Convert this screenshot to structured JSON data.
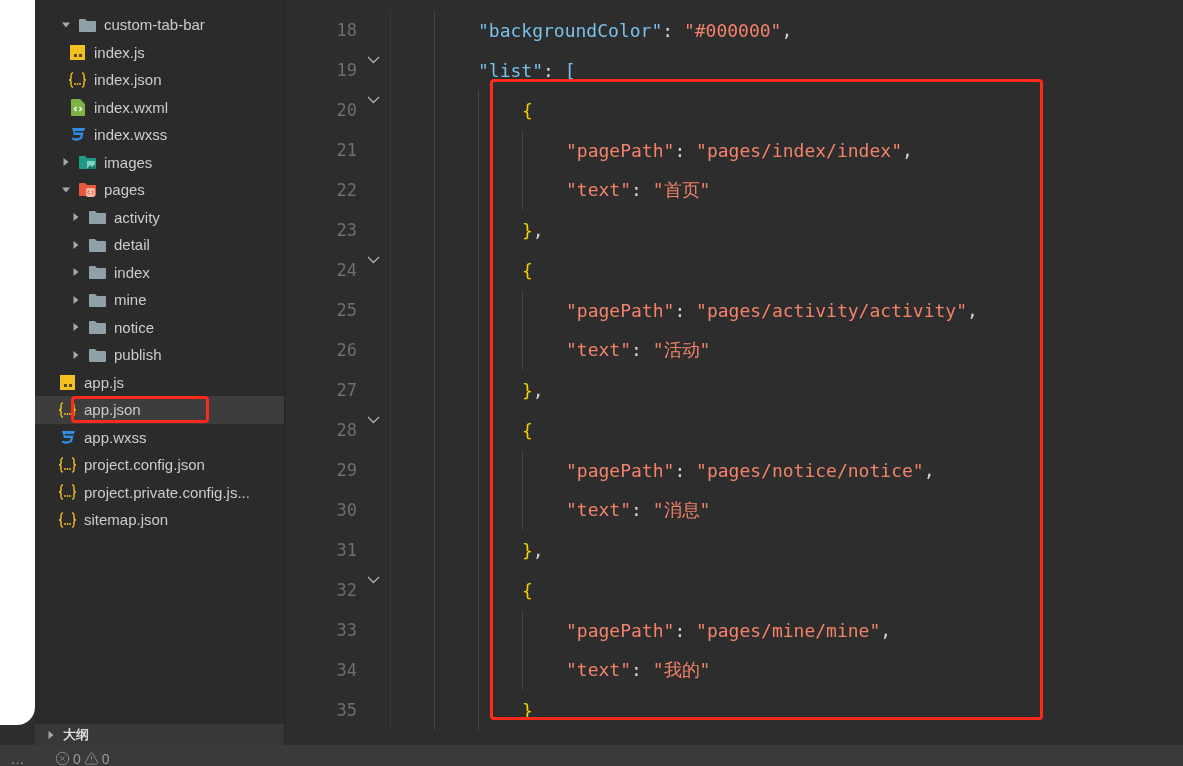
{
  "explorer": {
    "items": [
      {
        "name": "custom-tab-bar",
        "kind": "folder",
        "expanded": true,
        "selected": false,
        "children": [
          {
            "name": "index.js",
            "kind": "js",
            "selected": false
          },
          {
            "name": "index.json",
            "kind": "json",
            "selected": false
          },
          {
            "name": "index.wxml",
            "kind": "wxml",
            "selected": false
          },
          {
            "name": "index.wxss",
            "kind": "wxss",
            "selected": false
          }
        ]
      },
      {
        "name": "images",
        "kind": "image-folder",
        "expanded": false,
        "selected": false
      },
      {
        "name": "pages",
        "kind": "pages-folder",
        "expanded": true,
        "selected": false,
        "children": [
          {
            "name": "activity",
            "kind": "folder",
            "expanded": false,
            "selected": false
          },
          {
            "name": "detail",
            "kind": "folder",
            "expanded": false,
            "selected": false
          },
          {
            "name": "index",
            "kind": "folder",
            "expanded": false,
            "selected": false
          },
          {
            "name": "mine",
            "kind": "folder",
            "expanded": false,
            "selected": false
          },
          {
            "name": "notice",
            "kind": "folder",
            "expanded": false,
            "selected": false
          },
          {
            "name": "publish",
            "kind": "folder",
            "expanded": false,
            "selected": false
          }
        ]
      },
      {
        "name": "app.js",
        "kind": "js",
        "selected": false
      },
      {
        "name": "app.json",
        "kind": "json",
        "selected": true
      },
      {
        "name": "app.wxss",
        "kind": "wxss",
        "selected": false
      },
      {
        "name": "project.config.json",
        "kind": "json",
        "selected": false
      },
      {
        "name": "project.private.config.js...",
        "kind": "json",
        "selected": false
      },
      {
        "name": "sitemap.json",
        "kind": "json",
        "selected": false
      }
    ]
  },
  "outline": {
    "title": "大纲",
    "expanded": false
  },
  "editor": {
    "lines": [
      {
        "number": "18",
        "fold": false,
        "tokens": [
          {
            "kind": "prop",
            "text": "\"backgroundColor\""
          },
          {
            "kind": "punct",
            "text": ": "
          },
          {
            "kind": "str",
            "text": "\"#000000\""
          },
          {
            "kind": "punct",
            "text": ","
          }
        ]
      },
      {
        "number": "19",
        "fold": true,
        "tokens": [
          {
            "kind": "prop",
            "text": "\"list\""
          },
          {
            "kind": "punct",
            "text": ": "
          },
          {
            "kind": "bracket",
            "text": "["
          }
        ],
        "children": [
          {
            "number": "20",
            "fold": true,
            "tokens": [
              {
                "kind": "brace",
                "text": "{"
              }
            ],
            "children": [
              {
                "number": "21",
                "fold": false,
                "tokens": [
                  {
                    "kind": "key",
                    "text": "\"pagePath\""
                  },
                  {
                    "kind": "punct",
                    "text": ": "
                  },
                  {
                    "kind": "str",
                    "text": "\"pages/index/index\""
                  },
                  {
                    "kind": "punct",
                    "text": ","
                  }
                ]
              },
              {
                "number": "22",
                "fold": false,
                "tokens": [
                  {
                    "kind": "key",
                    "text": "\"text\""
                  },
                  {
                    "kind": "punct",
                    "text": ": "
                  },
                  {
                    "kind": "str",
                    "text": "\"首页\""
                  }
                ]
              }
            ]
          },
          {
            "number": "23",
            "fold": false,
            "tokens": [
              {
                "kind": "brace",
                "text": "}"
              },
              {
                "kind": "punct",
                "text": ","
              }
            ]
          },
          {
            "number": "24",
            "fold": true,
            "tokens": [
              {
                "kind": "brace",
                "text": "{"
              }
            ],
            "children": [
              {
                "number": "25",
                "fold": false,
                "tokens": [
                  {
                    "kind": "key",
                    "text": "\"pagePath\""
                  },
                  {
                    "kind": "punct",
                    "text": ": "
                  },
                  {
                    "kind": "str",
                    "text": "\"pages/activity/activity\""
                  },
                  {
                    "kind": "punct",
                    "text": ","
                  }
                ]
              },
              {
                "number": "26",
                "fold": false,
                "tokens": [
                  {
                    "kind": "key",
                    "text": "\"text\""
                  },
                  {
                    "kind": "punct",
                    "text": ": "
                  },
                  {
                    "kind": "str",
                    "text": "\"活动\""
                  }
                ]
              }
            ]
          },
          {
            "number": "27",
            "fold": false,
            "tokens": [
              {
                "kind": "brace",
                "text": "}"
              },
              {
                "kind": "punct",
                "text": ","
              }
            ]
          },
          {
            "number": "28",
            "fold": true,
            "tokens": [
              {
                "kind": "brace",
                "text": "{"
              }
            ],
            "children": [
              {
                "number": "29",
                "fold": false,
                "tokens": [
                  {
                    "kind": "key",
                    "text": "\"pagePath\""
                  },
                  {
                    "kind": "punct",
                    "text": ": "
                  },
                  {
                    "kind": "str",
                    "text": "\"pages/notice/notice\""
                  },
                  {
                    "kind": "punct",
                    "text": ","
                  }
                ]
              },
              {
                "number": "30",
                "fold": false,
                "tokens": [
                  {
                    "kind": "key",
                    "text": "\"text\""
                  },
                  {
                    "kind": "punct",
                    "text": ": "
                  },
                  {
                    "kind": "str",
                    "text": "\"消息\""
                  }
                ]
              }
            ]
          },
          {
            "number": "31",
            "fold": false,
            "tokens": [
              {
                "kind": "brace",
                "text": "}"
              },
              {
                "kind": "punct",
                "text": ","
              }
            ]
          },
          {
            "number": "32",
            "fold": true,
            "tokens": [
              {
                "kind": "brace",
                "text": "{"
              }
            ],
            "children": [
              {
                "number": "33",
                "fold": false,
                "tokens": [
                  {
                    "kind": "key",
                    "text": "\"pagePath\""
                  },
                  {
                    "kind": "punct",
                    "text": ": "
                  },
                  {
                    "kind": "str",
                    "text": "\"pages/mine/mine\""
                  },
                  {
                    "kind": "punct",
                    "text": ","
                  }
                ]
              },
              {
                "number": "34",
                "fold": false,
                "tokens": [
                  {
                    "kind": "key",
                    "text": "\"text\""
                  },
                  {
                    "kind": "punct",
                    "text": ": "
                  },
                  {
                    "kind": "str",
                    "text": "\"我的\""
                  }
                ]
              }
            ]
          },
          {
            "number": "35",
            "fold": false,
            "tokens": [
              {
                "kind": "brace",
                "text": "}"
              }
            ]
          }
        ]
      }
    ]
  },
  "status_bar": {
    "more": "…",
    "errors": "0",
    "warnings": "0"
  }
}
